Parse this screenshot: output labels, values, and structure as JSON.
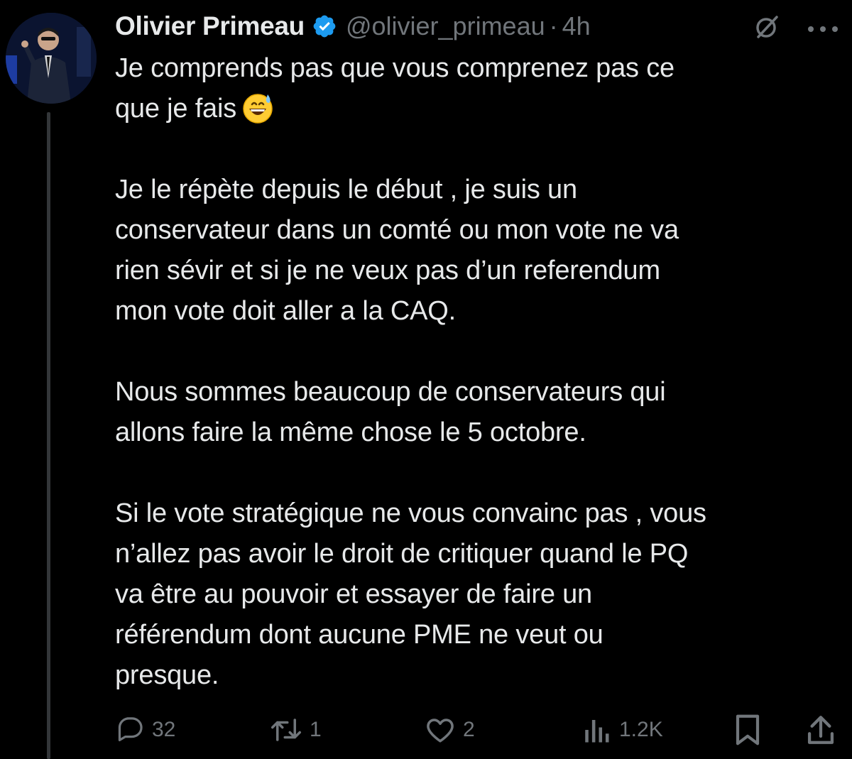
{
  "tweet": {
    "author": {
      "display_name": "Olivier Primeau",
      "handle": "@olivier_primeau",
      "verified": true,
      "verified_color": "#1d9bf0"
    },
    "separator": "·",
    "time": "4h",
    "body": {
      "paragraphs": [
        {
          "lines": [
            "Je comprends pas que vous comprenez pas ce",
            "que je fais"
          ],
          "trailing_emoji": "grinning-face-with-sweat"
        },
        {
          "lines": [
            "Je le répète depuis le début , je suis un",
            "conservateur dans un comté ou mon vote ne va",
            "rien sévir et si je ne veux pas d’un referendum",
            "mon vote doit aller a la CAQ."
          ]
        },
        {
          "lines": [
            "Nous sommes beaucoup de conservateurs qui",
            "allons faire la même chose le 5 octobre."
          ]
        },
        {
          "lines": [
            "Si le vote stratégique ne vous convainc pas , vous",
            "n’allez pas avoir le droit de critiquer quand le PQ",
            "va être au pouvoir et essayer de faire un",
            "référendum dont aucune PME ne veut ou",
            "presque."
          ]
        }
      ]
    },
    "actions": {
      "reply_count": "32",
      "retweet_count": "1",
      "like_count": "2",
      "view_count": "1.2K"
    },
    "icons": {
      "header": [
        "grok-icon",
        "more-icon"
      ],
      "actions": [
        "reply-icon",
        "retweet-icon",
        "like-icon",
        "views-icon",
        "bookmark-icon",
        "share-icon"
      ]
    },
    "colors": {
      "background": "#000000",
      "text": "#e7e9ea",
      "secondary": "#71767b",
      "thread_line": "#333639"
    }
  }
}
